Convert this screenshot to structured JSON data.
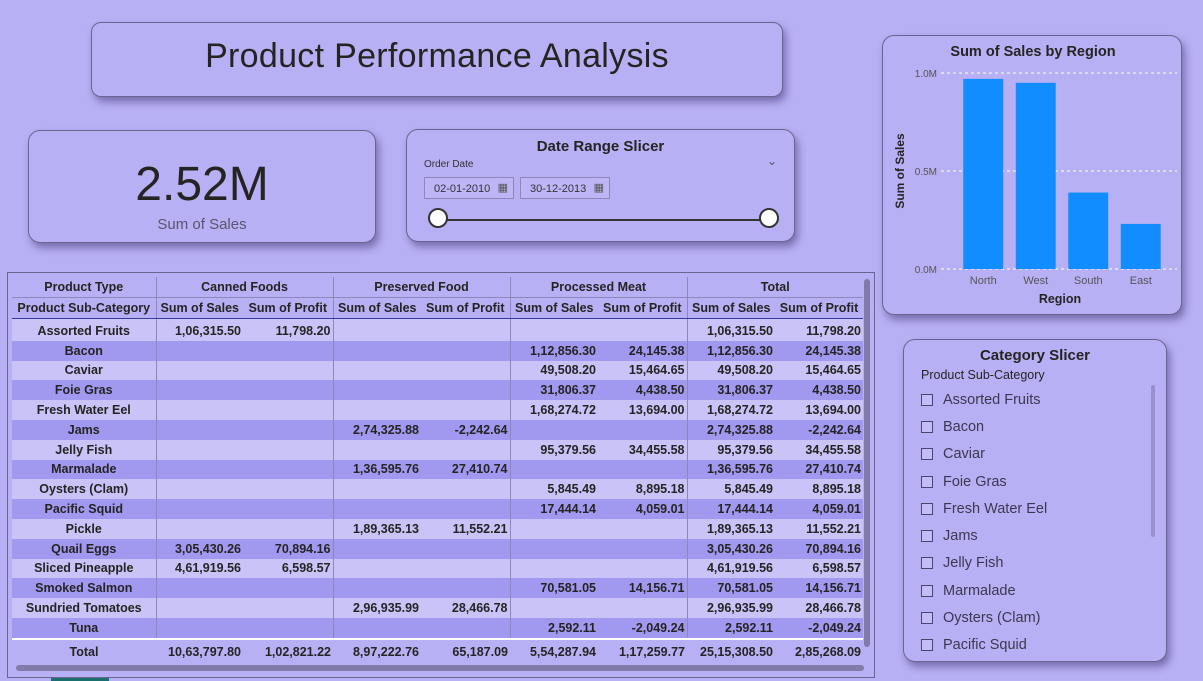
{
  "title": "Product Performance Analysis",
  "kpi": {
    "value": "2.52M",
    "label": "Sum of Sales"
  },
  "date_slicer": {
    "title": "Date Range Slicer",
    "field": "Order Date",
    "start": "02-01-2010",
    "end": "30-12-2013",
    "calendar_icon": "calendar-icon",
    "chevron_icon": "chevron-down-icon"
  },
  "chart_data": {
    "type": "bar",
    "title": "Sum of Sales by Region",
    "xlabel": "Region",
    "ylabel": "Sum of Sales",
    "categories": [
      "North",
      "West",
      "South",
      "East"
    ],
    "values": [
      970000,
      950000,
      390000,
      230000
    ],
    "ylim": [
      0,
      1000000
    ],
    "yticks": [
      0,
      500000,
      1000000
    ],
    "ytick_labels": [
      "0.0M",
      "0.5M",
      "1.0M"
    ],
    "bar_color": "#118dff",
    "grid": true
  },
  "matrix": {
    "header_row1": [
      "Product Type",
      "Canned Foods",
      "Preserved Food",
      "Processed Meat",
      "Total"
    ],
    "header_row2": [
      "Product Sub-Category",
      "Sum of Sales",
      "Sum of Profit",
      "Sum of Sales",
      "Sum of Profit",
      "Sum of Sales",
      "Sum of Profit",
      "Sum of Sales",
      "Sum of Profit"
    ],
    "rows": [
      [
        "Assorted Fruits",
        "1,06,315.50",
        "11,798.20",
        "",
        "",
        "",
        "",
        "1,06,315.50",
        "11,798.20"
      ],
      [
        "Bacon",
        "",
        "",
        "",
        "",
        "1,12,856.30",
        "24,145.38",
        "1,12,856.30",
        "24,145.38"
      ],
      [
        "Caviar",
        "",
        "",
        "",
        "",
        "49,508.20",
        "15,464.65",
        "49,508.20",
        "15,464.65"
      ],
      [
        "Foie Gras",
        "",
        "",
        "",
        "",
        "31,806.37",
        "4,438.50",
        "31,806.37",
        "4,438.50"
      ],
      [
        "Fresh Water Eel",
        "",
        "",
        "",
        "",
        "1,68,274.72",
        "13,694.00",
        "1,68,274.72",
        "13,694.00"
      ],
      [
        "Jams",
        "",
        "",
        "2,74,325.88",
        "-2,242.64",
        "",
        "",
        "2,74,325.88",
        "-2,242.64"
      ],
      [
        "Jelly Fish",
        "",
        "",
        "",
        "",
        "95,379.56",
        "34,455.58",
        "95,379.56",
        "34,455.58"
      ],
      [
        "Marmalade",
        "",
        "",
        "1,36,595.76",
        "27,410.74",
        "",
        "",
        "1,36,595.76",
        "27,410.74"
      ],
      [
        "Oysters (Clam)",
        "",
        "",
        "",
        "",
        "5,845.49",
        "8,895.18",
        "5,845.49",
        "8,895.18"
      ],
      [
        "Pacific Squid",
        "",
        "",
        "",
        "",
        "17,444.14",
        "4,059.01",
        "17,444.14",
        "4,059.01"
      ],
      [
        "Pickle",
        "",
        "",
        "1,89,365.13",
        "11,552.21",
        "",
        "",
        "1,89,365.13",
        "11,552.21"
      ],
      [
        "Quail Eggs",
        "3,05,430.26",
        "70,894.16",
        "",
        "",
        "",
        "",
        "3,05,430.26",
        "70,894.16"
      ],
      [
        "Sliced Pineapple",
        "4,61,919.56",
        "6,598.57",
        "",
        "",
        "",
        "",
        "4,61,919.56",
        "6,598.57"
      ],
      [
        "Smoked Salmon",
        "",
        "",
        "",
        "",
        "70,581.05",
        "14,156.71",
        "70,581.05",
        "14,156.71"
      ],
      [
        "Sundried Tomatoes",
        "",
        "",
        "2,96,935.99",
        "28,466.78",
        "",
        "",
        "2,96,935.99",
        "28,466.78"
      ],
      [
        "Tuna",
        "",
        "",
        "",
        "",
        "2,592.11",
        "-2,049.24",
        "2,592.11",
        "-2,049.24"
      ]
    ],
    "total": [
      "Total",
      "10,63,797.80",
      "1,02,821.22",
      "8,97,222.76",
      "65,187.09",
      "5,54,287.94",
      "1,17,259.77",
      "25,15,308.50",
      "2,85,268.09"
    ]
  },
  "category_slicer": {
    "title": "Category Slicer",
    "field": "Product Sub-Category",
    "items": [
      "Assorted Fruits",
      "Bacon",
      "Caviar",
      "Foie Gras",
      "Fresh Water Eel",
      "Jams",
      "Jelly Fish",
      "Marmalade",
      "Oysters (Clam)",
      "Pacific Squid"
    ]
  }
}
